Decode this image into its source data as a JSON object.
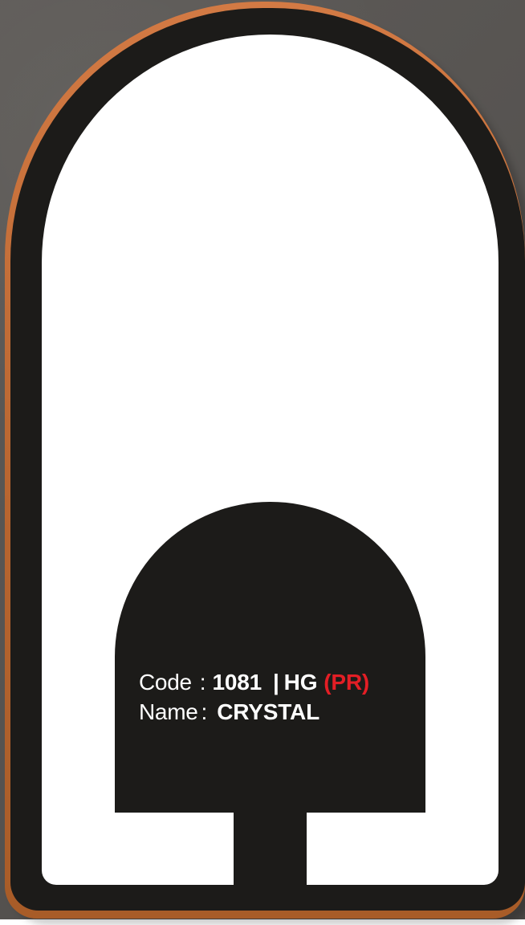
{
  "colors": {
    "background": "#565351",
    "outline": "#c66f3a",
    "tag_body": "#1c1b19",
    "cutout": "#ffffff",
    "text": "#ffffff",
    "accent": "#e31e25"
  },
  "label": {
    "code_key": "Code",
    "separator": ":",
    "code_number": "1081",
    "code_pipe": "|",
    "code_suffix": "HG",
    "code_tag": "(PR)",
    "name_key": "Name",
    "name_value": "CRYSTAL"
  }
}
